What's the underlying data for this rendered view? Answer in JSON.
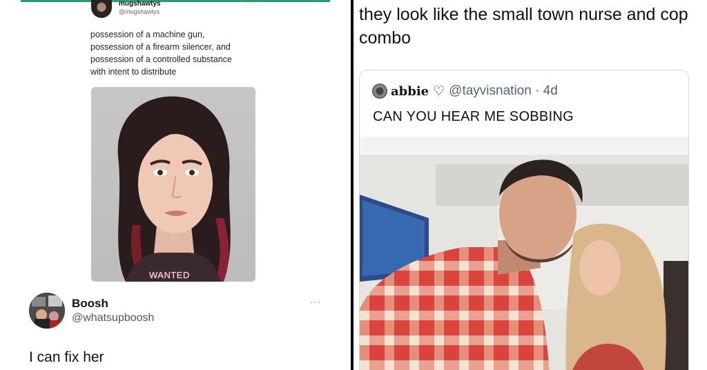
{
  "left_panel": {
    "quoted_tweet": {
      "display_name": "mugshawtys",
      "handle": "@mugshawtys",
      "body_lines": [
        "possession of a machine gun,",
        "possession of a firearm silencer, and",
        "possession of a controlled substance",
        "with intent to distribute"
      ],
      "image_overlay_text": "WANTED",
      "more_icon": "more-dots-icon"
    },
    "reply": {
      "display_name": "Boosh",
      "handle": "@whatsupboosh",
      "text": "I can fix her",
      "more_icon": "more-dots-icon"
    }
  },
  "right_panel": {
    "caption": "they look like the small town nurse and cop combo",
    "quoted_tweet": {
      "display_name": "abbie",
      "heart_glyph": "♡",
      "handle_and_time": "@tayvisnation · 4d",
      "text": "CAN YOU HEAR ME SOBBING"
    }
  },
  "colors": {
    "accent_line": "#2f9a7a",
    "handle_gray": "#536471",
    "divider": "#000000"
  }
}
